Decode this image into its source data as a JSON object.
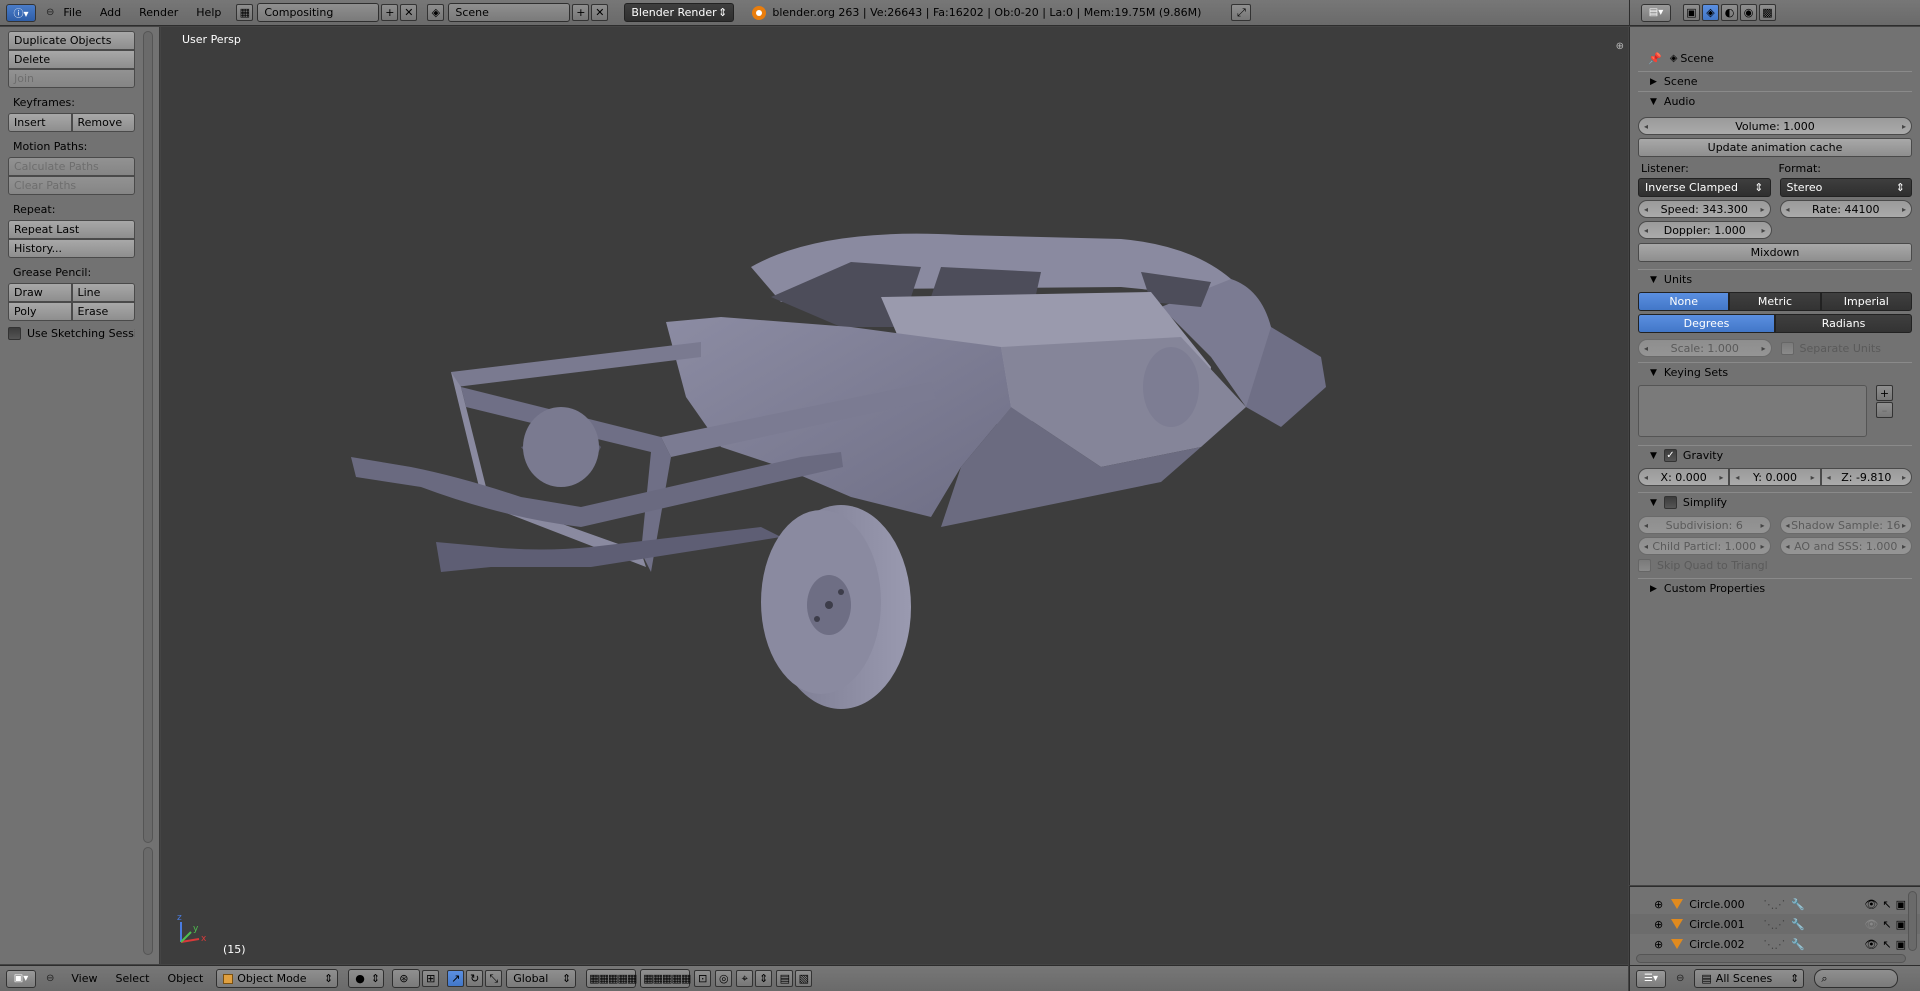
{
  "header": {
    "menus": [
      "File",
      "Add",
      "Render",
      "Help"
    ],
    "layout_screen": "Compositing",
    "scene_name": "Scene",
    "render_engine": "Blender Render",
    "stats": "blender.org 263 | Ve:26643 | Fa:16202 | Ob:0-20 | La:0 | Mem:19.75M (9.86M)"
  },
  "toolshelf": {
    "object_ops": [
      "Duplicate Objects",
      "Delete",
      "Join"
    ],
    "keyframes_label": "Keyframes:",
    "keyframes": [
      "Insert",
      "Remove"
    ],
    "motion_paths_label": "Motion Paths:",
    "motion_paths": [
      "Calculate Paths",
      "Clear Paths"
    ],
    "repeat_label": "Repeat:",
    "repeat": [
      "Repeat Last",
      "History..."
    ],
    "grease_label": "Grease Pencil:",
    "grease": [
      "Draw",
      "Line",
      "Poly",
      "Erase"
    ],
    "sketching": "Use Sketching Sessio"
  },
  "viewport": {
    "view_label": "User Persp",
    "frame": "(15)",
    "axis_x": "x",
    "axis_y": "y",
    "axis_z": "z"
  },
  "bottombar": {
    "menus": [
      "View",
      "Select",
      "Object"
    ],
    "mode": "Object Mode",
    "orientation": "Global"
  },
  "props": {
    "breadcrumb": "Scene",
    "scene_panel": "Scene",
    "audio_panel": "Audio",
    "volume": "Volume: 1.000",
    "update_cache": "Update animation cache",
    "listener_label": "Listener:",
    "format_label": "Format:",
    "listener": "Inverse Clamped",
    "format": "Stereo",
    "speed": "Speed: 343.300",
    "rate": "Rate: 44100",
    "doppler": "Doppler: 1.000",
    "mixdown": "Mixdown",
    "units_panel": "Units",
    "units": [
      "None",
      "Metric",
      "Imperial"
    ],
    "angle": [
      "Degrees",
      "Radians"
    ],
    "scale": "Scale: 1.000",
    "separate_units": "Separate Units",
    "keying_panel": "Keying Sets",
    "gravity_panel": "Gravity",
    "gx": "X: 0.000",
    "gy": "Y: 0.000",
    "gz": "Z: -9.810",
    "simplify_panel": "Simplify",
    "subdivision": "Subdivision: 6",
    "shadow": "Shadow Sample: 16",
    "child": "Child Particl: 1.000",
    "ao": "AO and SSS: 1.000",
    "skip_quad": "Skip Quad to Triangl",
    "custom_panel": "Custom Properties"
  },
  "outliner": {
    "rows": [
      "Circle.000",
      "Circle.001",
      "Circle.002"
    ],
    "filter": "All Scenes"
  },
  "colors": {
    "accent": "#5b8fe0",
    "background": "#727272",
    "viewport": "#3d3d3d"
  }
}
